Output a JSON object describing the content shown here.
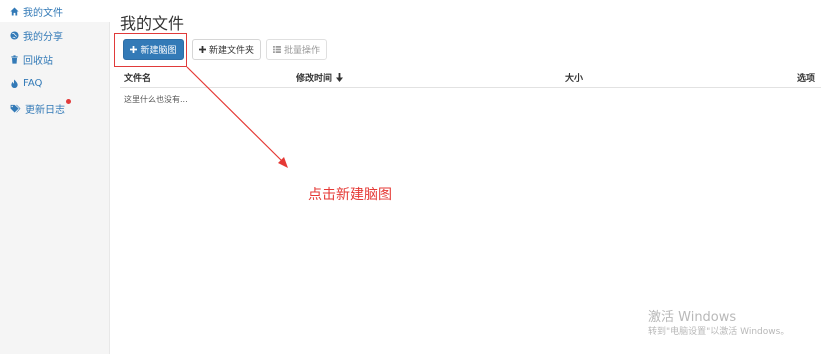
{
  "sidebar": {
    "items": [
      {
        "label": "我的文件",
        "icon": "home-icon"
      },
      {
        "label": "我的分享",
        "icon": "globe-icon"
      },
      {
        "label": "回收站",
        "icon": "trash-icon"
      },
      {
        "label": "FAQ",
        "icon": "fire-icon"
      },
      {
        "label": "更新日志",
        "icon": "tags-icon"
      }
    ]
  },
  "main": {
    "title": "我的文件",
    "toolbar": {
      "new_mindmap": "新建脑图",
      "new_folder": "新建文件夹",
      "batch": "批量操作"
    },
    "table": {
      "headers": {
        "name": "文件名",
        "modified": "修改时间",
        "size": "大小",
        "options": "选项"
      },
      "empty_text": "这里什么也没有..."
    }
  },
  "annotation": {
    "text": "点击新建脑图",
    "color": "#e53935"
  },
  "watermark": {
    "title": "激活 Windows",
    "subtitle": "转到\"电脑设置\"以激活 Windows。"
  },
  "colors": {
    "primary": "#337ab7",
    "annotation": "#e53935",
    "badge": "#e23b3b"
  }
}
